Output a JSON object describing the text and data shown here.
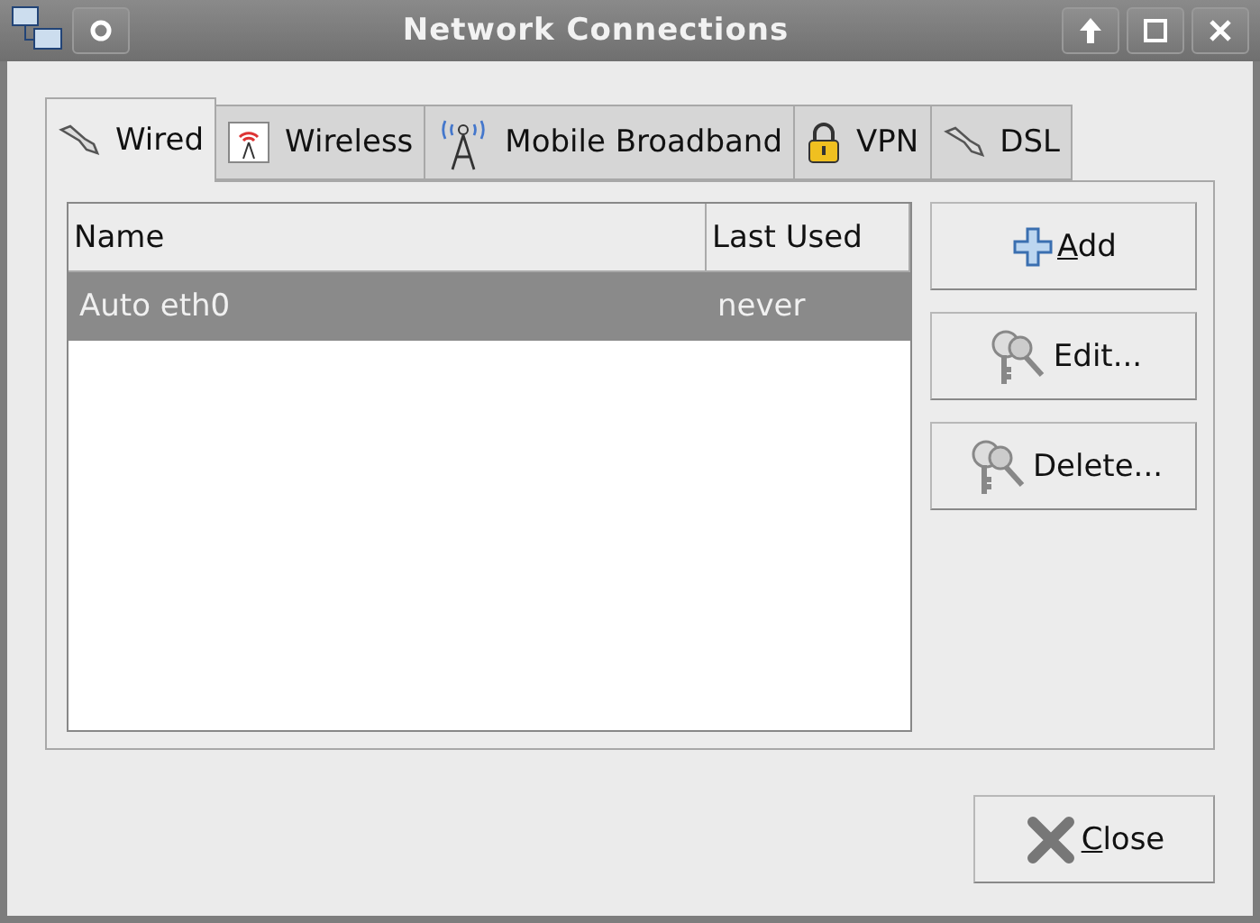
{
  "window": {
    "title": "Network Connections"
  },
  "tabs": [
    {
      "label": "Wired",
      "kind": "plug",
      "selected": true
    },
    {
      "label": "Wireless",
      "kind": "wifi",
      "selected": false
    },
    {
      "label": "Mobile Broadband",
      "kind": "antenna",
      "selected": false
    },
    {
      "label": "VPN",
      "kind": "lock",
      "selected": false
    },
    {
      "label": "DSL",
      "kind": "plug",
      "selected": false
    }
  ],
  "table": {
    "columns": [
      "Name",
      "Last Used"
    ],
    "rows": [
      {
        "cells": [
          "Auto eth0",
          "never"
        ],
        "selected": true
      }
    ]
  },
  "side_buttons": [
    {
      "label": "Add",
      "kind": "add",
      "mnemonic": true
    },
    {
      "label": "Edit...",
      "kind": "keys",
      "mnemonic": false
    },
    {
      "label": "Delete...",
      "kind": "keys",
      "mnemonic": false
    }
  ],
  "close_button": {
    "label": "Close",
    "mnemonic": true
  }
}
